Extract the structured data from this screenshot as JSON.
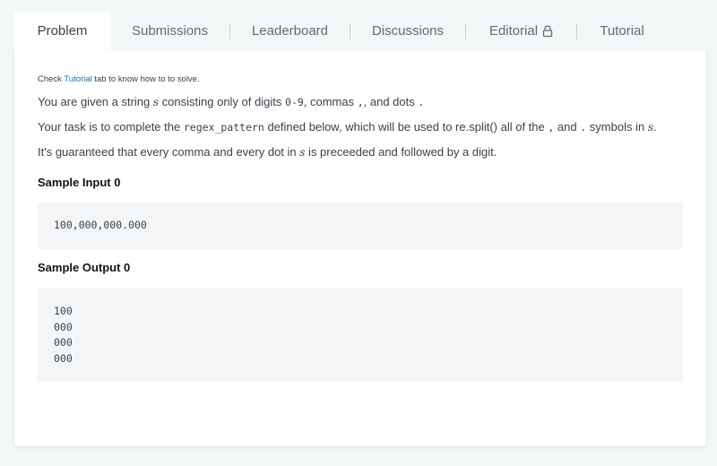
{
  "tabs": [
    {
      "label": "Problem"
    },
    {
      "label": "Submissions"
    },
    {
      "label": "Leaderboard"
    },
    {
      "label": "Discussions"
    },
    {
      "label": "Editorial"
    },
    {
      "label": "Tutorial"
    }
  ],
  "hint": {
    "prefix": "Check ",
    "link": "Tutorial",
    "suffix": " tab to know how to to solve."
  },
  "p1": {
    "a": "You are given a string ",
    "var": "s",
    "b": " consisting only of digits ",
    "code1": "0-9",
    "c": ", commas ",
    "code2": ",",
    "d": ", and dots ",
    "code3": "."
  },
  "p2": {
    "a": "Your task is to complete the ",
    "code1": "regex_pattern",
    "b": " defined below, which will be used to re.split() all of the ",
    "code2": ",",
    "c": " and ",
    "code3": ".",
    "d": " symbols in ",
    "var": "s",
    "e": "."
  },
  "p3": {
    "a": "It's guaranteed that every comma and every dot in ",
    "var": "s",
    "b": " is preceeded and followed by a digit."
  },
  "sample_input": {
    "heading": "Sample Input 0",
    "lines": [
      "100,000,000.000"
    ]
  },
  "sample_output": {
    "heading": "Sample Output 0",
    "lines": [
      "100",
      "000",
      "000",
      "000"
    ]
  },
  "icons": {
    "editorial_tab": "lock-icon"
  }
}
